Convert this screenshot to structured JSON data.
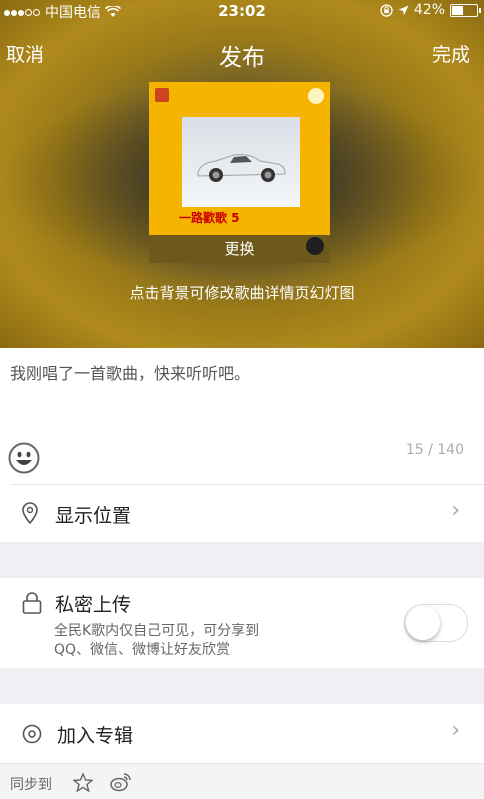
{
  "status_bar": {
    "carrier": "中国电信",
    "time": "23:02",
    "battery": "42%",
    "icons": [
      "signal-dots",
      "wifi-icon",
      "rotation-lock-icon",
      "location-arrow-icon",
      "battery-icon"
    ]
  },
  "nav": {
    "cancel": "取消",
    "title": "发布",
    "done": "完成"
  },
  "cover": {
    "title": "一路歡歌 5",
    "change_label": "更换"
  },
  "hint": "点击背景可修改歌曲详情页幻灯图",
  "editor": {
    "text": "我刚唱了一首歌曲，快来听听吧。",
    "count": "15 / 140",
    "emoji_icon": "smiley-icon"
  },
  "location": {
    "label": "显示位置",
    "icon": "location-pin-icon"
  },
  "private": {
    "label": "私密上传",
    "desc_line1": "全民K歌内仅自己可见，可分享到",
    "desc_line2": "QQ、微信、微博让好友欣赏",
    "toggle_on": false,
    "icon": "lock-icon"
  },
  "album": {
    "label": "加入专辑",
    "icon": "disc-icon"
  },
  "footer": {
    "sync_label": "同步到",
    "icons": [
      "qzone-star-icon",
      "weibo-icon"
    ]
  },
  "colors": {
    "hero_gold": "#b08a1c",
    "cover_yellow": "#f4b400",
    "page_bg": "#efeff4"
  }
}
